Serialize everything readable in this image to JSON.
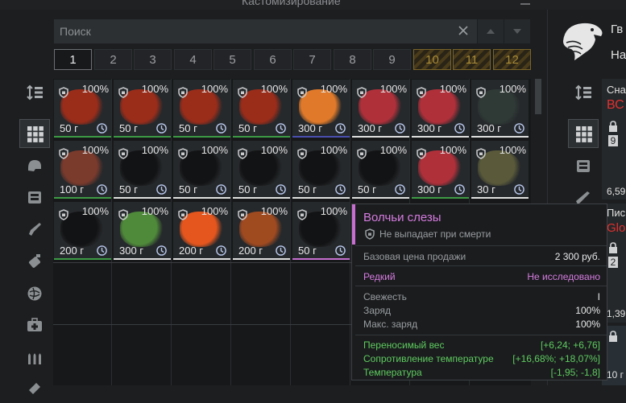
{
  "window": {
    "title": "Кастомизирование"
  },
  "search": {
    "placeholder": "Поиск",
    "value": ""
  },
  "pages": [
    {
      "label": "1",
      "state": "active"
    },
    {
      "label": "2",
      "state": "normal"
    },
    {
      "label": "3",
      "state": "normal"
    },
    {
      "label": "4",
      "state": "normal"
    },
    {
      "label": "5",
      "state": "normal"
    },
    {
      "label": "6",
      "state": "normal"
    },
    {
      "label": "7",
      "state": "normal"
    },
    {
      "label": "8",
      "state": "normal"
    },
    {
      "label": "9",
      "state": "normal"
    },
    {
      "label": "10",
      "state": "locked"
    },
    {
      "label": "11",
      "state": "locked"
    },
    {
      "label": "12",
      "state": "locked"
    }
  ],
  "left_toolbar": [
    {
      "icon": "sort-icon"
    },
    {
      "icon": "grid-icon",
      "active": true
    },
    {
      "icon": "helmet-icon"
    },
    {
      "icon": "armor-icon"
    },
    {
      "icon": "pistol-icon"
    },
    {
      "icon": "grenade-icon"
    },
    {
      "icon": "artifact-icon"
    },
    {
      "icon": "medkit-icon"
    },
    {
      "icon": "ammo-icon"
    },
    {
      "icon": "misc-icon"
    }
  ],
  "inventory": {
    "rows": [
      [
        {
          "percent": "100%",
          "weight": "50 г",
          "color": "#9a2c1a",
          "bar": "#3d9b45"
        },
        {
          "percent": "100%",
          "weight": "50 г",
          "color": "#9a2c1a",
          "bar": "#3d9b45"
        },
        {
          "percent": "100%",
          "weight": "50 г",
          "color": "#9a2c1a",
          "bar": "#3d9b45"
        },
        {
          "percent": "100%",
          "weight": "50 г",
          "color": "#9a2c1a",
          "bar": "#3d9b45"
        },
        {
          "percent": "100%",
          "weight": "300 г",
          "color": "#e07a2a",
          "bar": "#4a4fb0"
        },
        {
          "percent": "100%",
          "weight": "300 г",
          "color": "#b0303a",
          "bar": "#e0e0e0"
        },
        {
          "percent": "100%",
          "weight": "300 г",
          "color": "#b0303a",
          "bar": "#e0e0e0"
        },
        {
          "percent": "100%",
          "weight": "300 г",
          "color": "#2f3a36",
          "bar": "#e0e0e0"
        }
      ],
      [
        {
          "percent": "100%",
          "weight": "100 г",
          "color": "#7a3a2c",
          "bar": "#3d9b45"
        },
        {
          "percent": "100%",
          "weight": "50 г",
          "color": "#121314",
          "bar": "#e0e0e0"
        },
        {
          "percent": "100%",
          "weight": "50 г",
          "color": "#121314",
          "bar": "#e0e0e0"
        },
        {
          "percent": "100%",
          "weight": "50 г",
          "color": "#121314",
          "bar": "#e0e0e0"
        },
        {
          "percent": "100%",
          "weight": "50 г",
          "color": "#121314",
          "bar": "#e0e0e0"
        },
        {
          "percent": "100%",
          "weight": "50 г",
          "color": "#121314",
          "bar": "#e0e0e0"
        },
        {
          "percent": "100%",
          "weight": "300 г",
          "color": "#b0303a",
          "bar": "#3d9b45"
        },
        {
          "percent": "100%",
          "weight": "30 г",
          "color": "#5a5a3a",
          "bar": "#e0e0e0"
        }
      ],
      [
        {
          "percent": "100%",
          "weight": "200 г",
          "color": "#121314",
          "bar": "#3d9b45"
        },
        {
          "percent": "100%",
          "weight": "300 г",
          "color": "#4f8a3a",
          "bar": "#e0e0e0"
        },
        {
          "percent": "100%",
          "weight": "200 г",
          "color": "#e4561e",
          "bar": "#e0e0e0"
        },
        {
          "percent": "100%",
          "weight": "200 г",
          "color": "#a04a20",
          "bar": "#e0e0e0"
        },
        {
          "percent": "100%",
          "weight": "50 г",
          "color": "#121314",
          "bar": "#c76fd1"
        }
      ]
    ]
  },
  "right_panel": {
    "name_line1": "Гв",
    "name_line2": "На",
    "card1": {
      "title": "Сна",
      "subtitle": "ВС",
      "count": "9",
      "value": "6,59"
    },
    "card2": {
      "title": "Пис",
      "subtitle": "Glo",
      "count": "2",
      "value": "1,39"
    },
    "card3": {
      "value": "10 г"
    }
  },
  "tooltip": {
    "title": "Волчьи слезы",
    "drop_text": "Не выпадает при смерти",
    "price_label": "Базовая цена продажи",
    "price_value": "2 300 руб.",
    "rarity_label": "Редкий",
    "research_status": "Не исследовано",
    "stats": [
      {
        "label": "Свежесть",
        "value": "I"
      },
      {
        "label": "Заряд",
        "value": "100%"
      },
      {
        "label": "Макс. заряд",
        "value": "100%"
      }
    ],
    "effects": [
      {
        "label": "Переносимый вес",
        "value": "[+6,24; +6,76]"
      },
      {
        "label": "Сопротивление температуре",
        "value": "[+16,68%; +18,07%]"
      },
      {
        "label": "Температура",
        "value": "[-1,95; -1,8]"
      }
    ],
    "colors": {
      "title": "#d77ce0",
      "rare": "#d77ce0",
      "effect": "#5fcc5f"
    }
  }
}
